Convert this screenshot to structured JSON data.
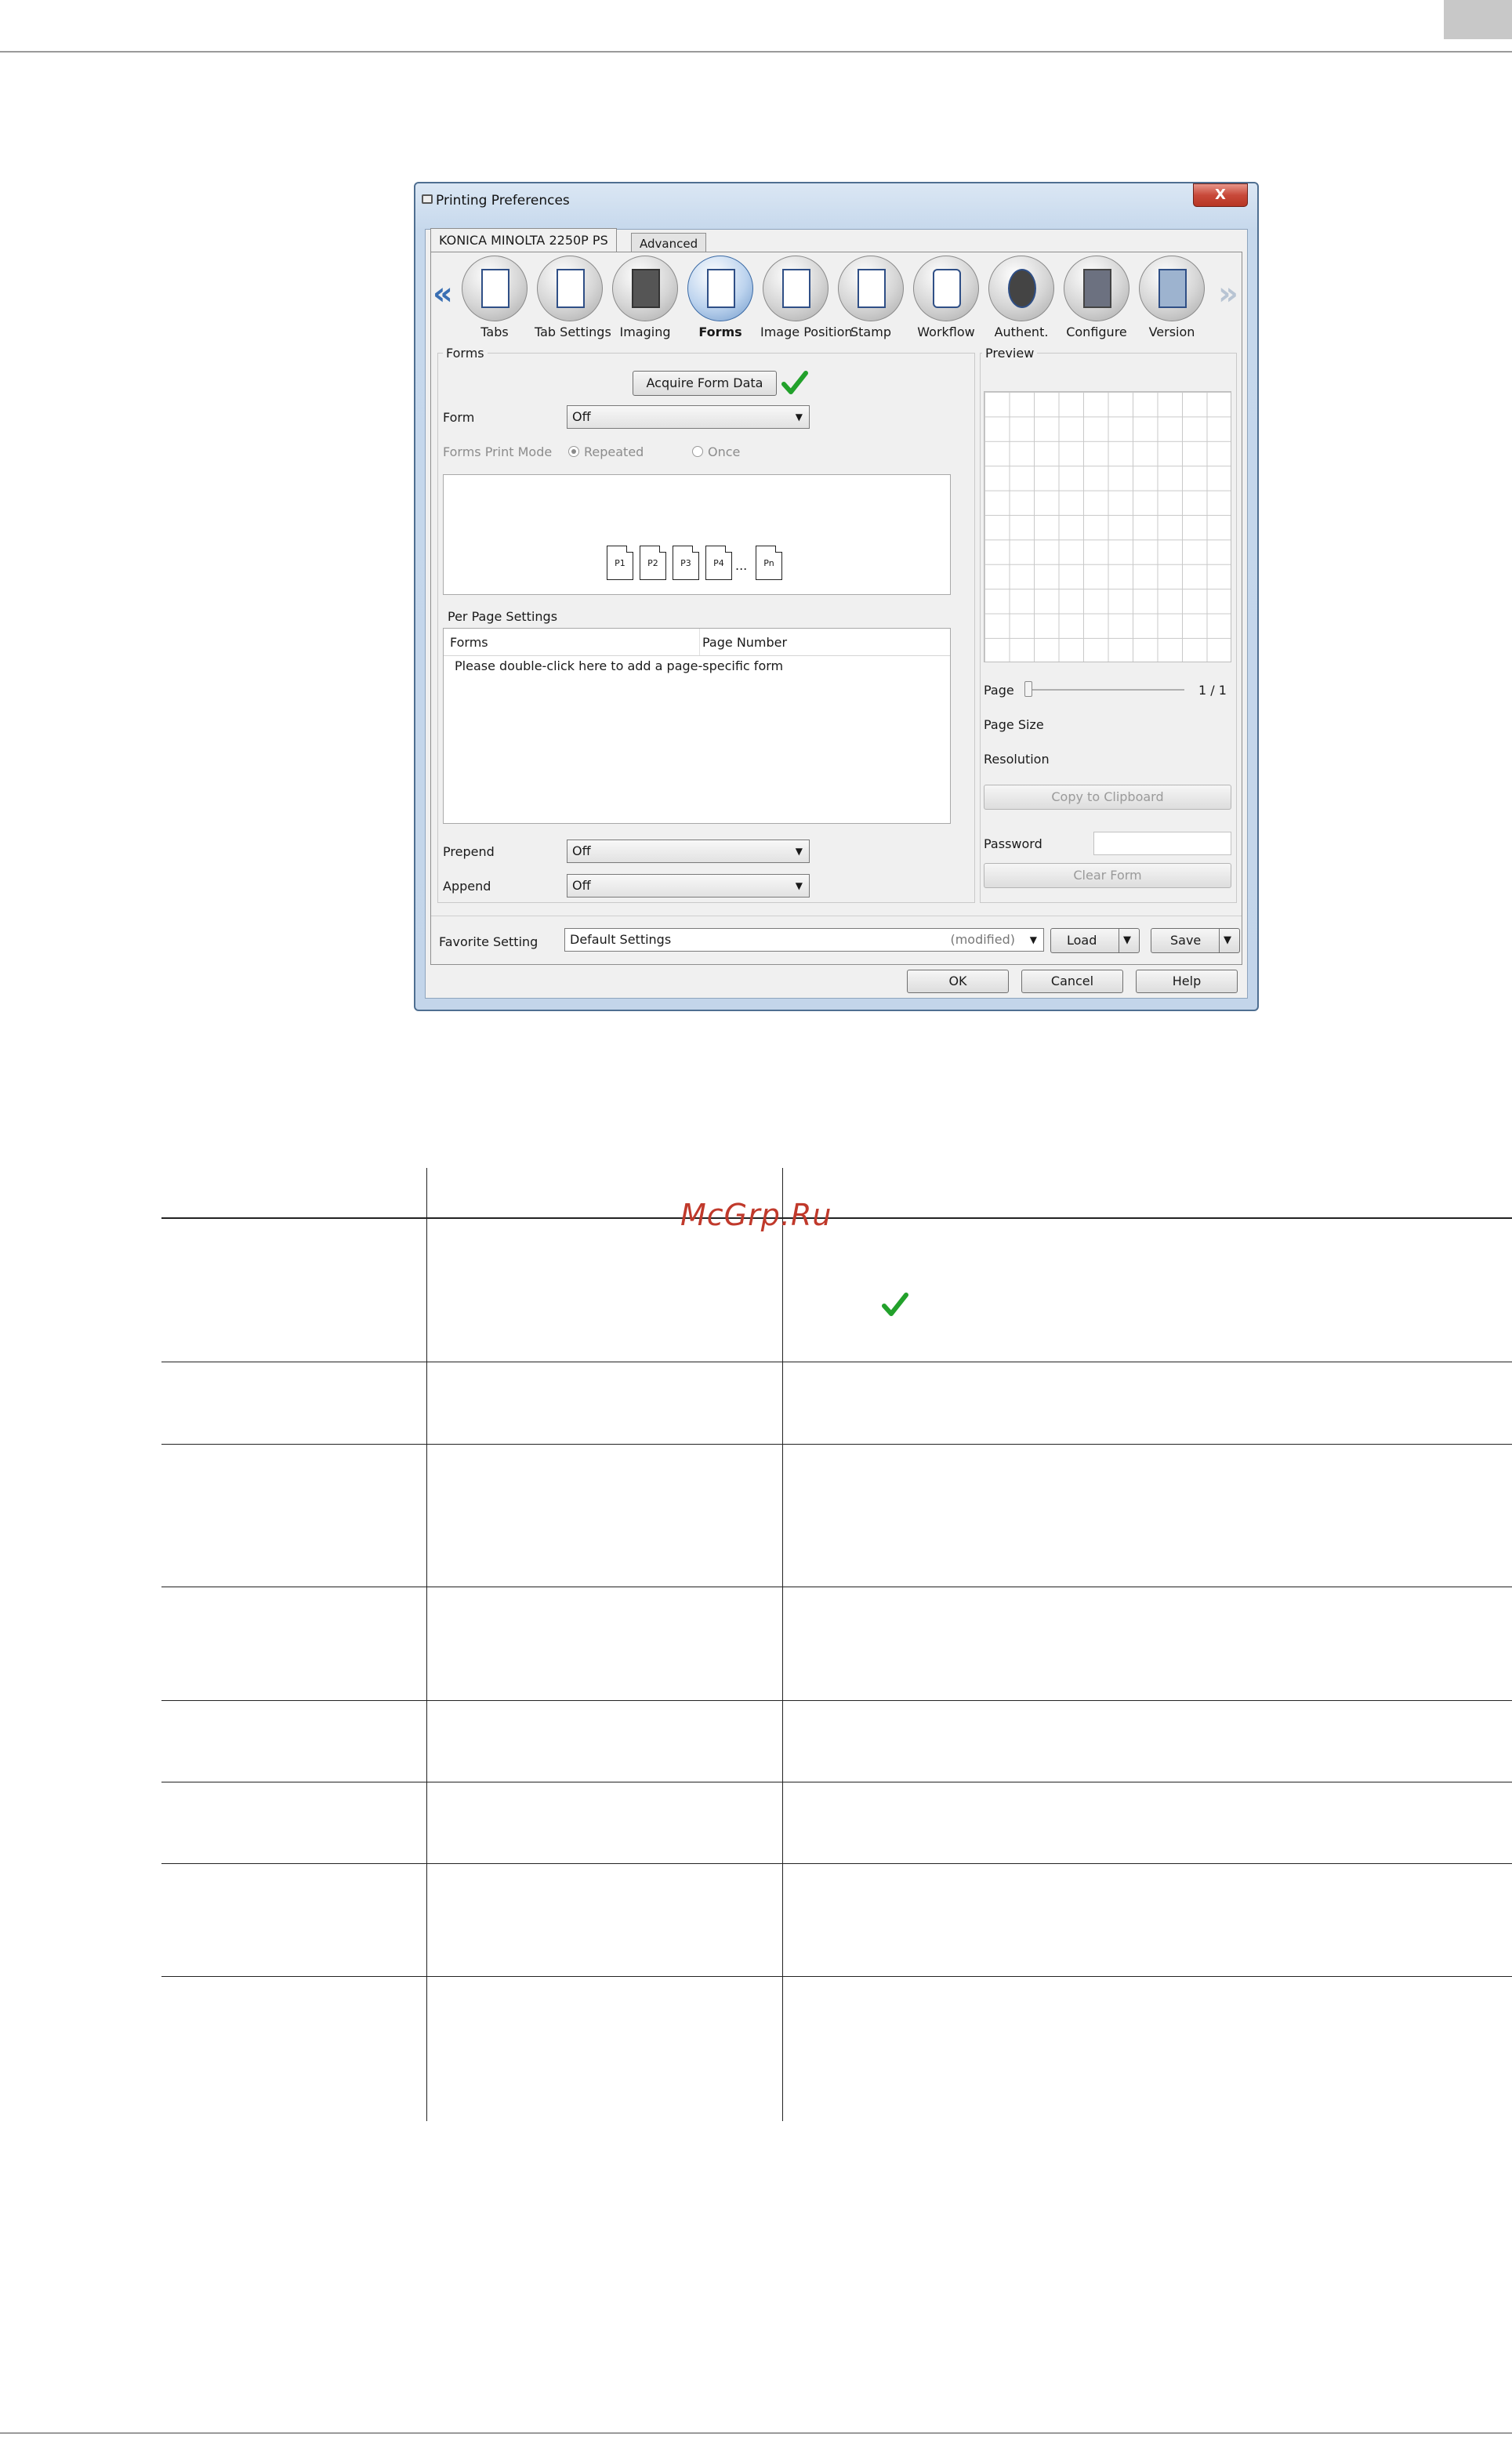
{
  "window": {
    "title": "Printing Preferences",
    "close_label": "X",
    "tabs": [
      "KONICA MINOLTA 2250P PS",
      "Advanced"
    ]
  },
  "toolbar": {
    "prev_arrow": "«",
    "next_arrow": "»",
    "items": [
      {
        "label": "Tabs",
        "icon": "tabs-icon"
      },
      {
        "label": "Tab Settings",
        "icon": "tab-settings-icon"
      },
      {
        "label": "Imaging",
        "icon": "imaging-icon"
      },
      {
        "label": "Forms",
        "icon": "forms-icon",
        "active": true
      },
      {
        "label": "Image Position",
        "icon": "image-position-icon"
      },
      {
        "label": "Stamp",
        "icon": "stamp-icon"
      },
      {
        "label": "Workflow",
        "icon": "workflow-icon"
      },
      {
        "label": "Authent.",
        "icon": "authentication-icon"
      },
      {
        "label": "Configure",
        "icon": "configure-icon"
      },
      {
        "label": "Version",
        "icon": "version-icon"
      }
    ]
  },
  "forms": {
    "group_title": "Forms",
    "acquire_button": "Acquire Form Data",
    "form_label": "Form",
    "form_value": "Off",
    "print_mode_label": "Forms Print Mode",
    "mode_repeated": "Repeated",
    "mode_once": "Once",
    "mode_selected": "Repeated",
    "pages": [
      "P1",
      "P2",
      "P3",
      "P4",
      "...",
      "Pn"
    ],
    "per_page": {
      "group_title": "Per Page Settings",
      "columns": [
        "Forms",
        "Page Number"
      ],
      "hint": "Please double-click here to add a page-specific form"
    },
    "prepend_label": "Prepend",
    "prepend_value": "Off",
    "append_label": "Append",
    "append_value": "Off"
  },
  "preview": {
    "group_title": "Preview",
    "page_label": "Page",
    "page_count": "1 / 1",
    "page_size_label": "Page Size",
    "resolution_label": "Resolution",
    "copy_button": "Copy to Clipboard",
    "password_label": "Password",
    "password_value": "",
    "clear_button": "Clear Form"
  },
  "favorite": {
    "label": "Favorite Setting",
    "value": "Default Settings",
    "modified": "(modified)",
    "load_button": "Load",
    "save_button": "Save"
  },
  "footer": {
    "ok": "OK",
    "cancel": "Cancel",
    "help": "Help"
  },
  "document": {
    "watermark": "McGrp.Ru",
    "check_color": "#1f9e2a"
  },
  "colors": {
    "checkmark": "#22a12b",
    "close_button": "#c8493a",
    "window_frame": "#4f6f91"
  }
}
